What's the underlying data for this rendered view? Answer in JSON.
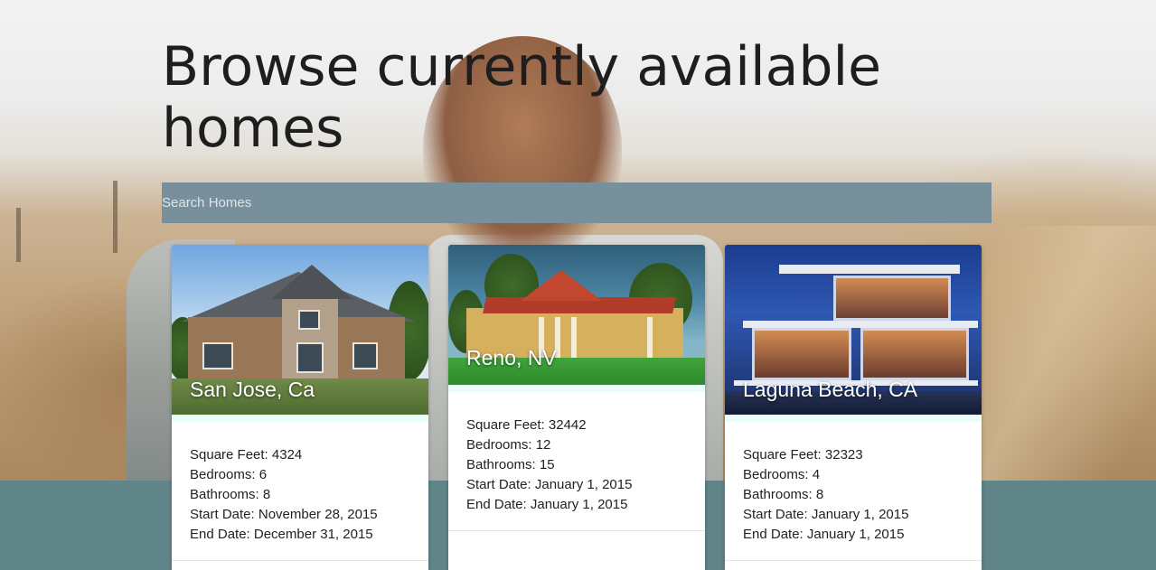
{
  "page": {
    "title": "Browse currently available homes"
  },
  "search": {
    "placeholder": "Search Homes"
  },
  "listings": [
    {
      "location": "San Jose, Ca",
      "square_feet": "Square Feet: 4324",
      "bedrooms": "Bedrooms: 6",
      "bathrooms": "Bathrooms: 8",
      "start_date": "Start Date: November 28, 2015",
      "end_date": "End Date: December 31, 2015"
    },
    {
      "location": "Reno, NV",
      "square_feet": "Square Feet: 32442",
      "bedrooms": "Bedrooms: 12",
      "bathrooms": "Bathrooms: 15",
      "start_date": "Start Date: January 1, 2015",
      "end_date": "End Date: January 1, 2015"
    },
    {
      "location": "Laguna Beach, CA",
      "square_feet": "Square Feet: 32323",
      "bedrooms": "Bedrooms: 4",
      "bathrooms": "Bathrooms: 8",
      "start_date": "Start Date: January 1, 2015",
      "end_date": "End Date: January 1, 2015"
    }
  ],
  "colors": {
    "search_bar": "#78909c",
    "footer_band": "#5f8589",
    "card_strip": "#eafdfd",
    "title_text": "#1e1e1e"
  }
}
